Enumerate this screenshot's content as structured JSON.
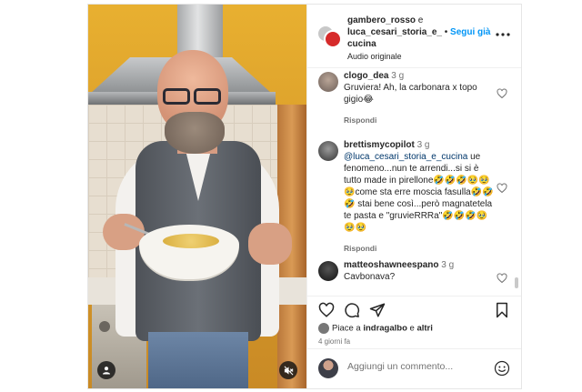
{
  "header": {
    "author1": "gambero_rosso",
    "joiner": " e",
    "author2": "luca_cesari_storia_e_",
    "separator": " • ",
    "follow_label": "Segui già",
    "author2_tail": "cucina",
    "audio_label": "Audio originale",
    "more_icon": "more-horizontal-icon"
  },
  "comments": [
    {
      "user": "clogo_dea",
      "time": "3 g",
      "text": "Gruviera! Ah, la carbonara x topo gigio😂",
      "reply_label": "Rispondi",
      "avatar_color": "#8a7a70"
    },
    {
      "user": "brettismycopilot",
      "time": "3 g",
      "mention": "@luca_cesari_storia_e_cucina",
      "text": " ue fenomeno...nun te arrendi...si si è tutto made in pirellone🤣🤣🤣🥹🥹🥹come sta erre moscia fasulla🤣🤣🤣 stai bene così...però magnatetela te pasta e \"gruvieRRRa\"🤣🤣🤣🥹🥹🥹",
      "reply_label": "Rispondi",
      "avatar_color": "#4a4a4a"
    },
    {
      "user": "matteoshawneespano",
      "time": "3 g",
      "text": "Cavbonava?",
      "avatar_color": "#222222"
    }
  ],
  "actions": {
    "like_icon": "heart-icon",
    "comment_icon": "comment-icon",
    "share_icon": "share-icon",
    "save_icon": "bookmark-icon"
  },
  "likes": {
    "prefix": "Piace a ",
    "user": "indragalbo",
    "middle": " e ",
    "others": "altri"
  },
  "post_date": "4 giorni fa",
  "comment_box": {
    "placeholder": "Aggiungi un commento...",
    "emoji_icon": "emoji-icon"
  },
  "colors": {
    "accent": "#0095f6",
    "text": "#262626",
    "muted": "#737373"
  }
}
